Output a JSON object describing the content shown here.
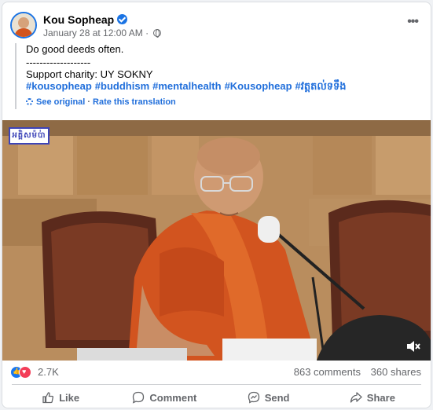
{
  "post": {
    "author": "Kou Sopheap",
    "date": "January 28 at 12:00 AM",
    "meta_sep": "·",
    "lines": [
      "Do good deeds often.",
      "-------------------",
      "Support charity: UY SOKNY"
    ],
    "hashtags": [
      "#kousopheap",
      "#buddhism",
      "#mentalhealth",
      "#Kousopheap",
      "#វត្តតល់ទទឹង"
    ],
    "see_original": "See original",
    "rate_translation": "Rate this translation",
    "translation_sep": "·"
  },
  "media": {
    "watermark_text": "អគ្គិសម៉ប់ា",
    "mute_icon": "speaker-muted-icon"
  },
  "reactions": {
    "count": "2.7K",
    "comments": "863 comments",
    "shares": "360 shares"
  },
  "actions": {
    "like": "Like",
    "comment": "Comment",
    "send": "Send",
    "share": "Share"
  },
  "colors": {
    "link_blue": "#216fdb",
    "verified_blue": "#1b74e4",
    "robe_orange": "#d2541f",
    "secondary_text": "#65676b"
  }
}
